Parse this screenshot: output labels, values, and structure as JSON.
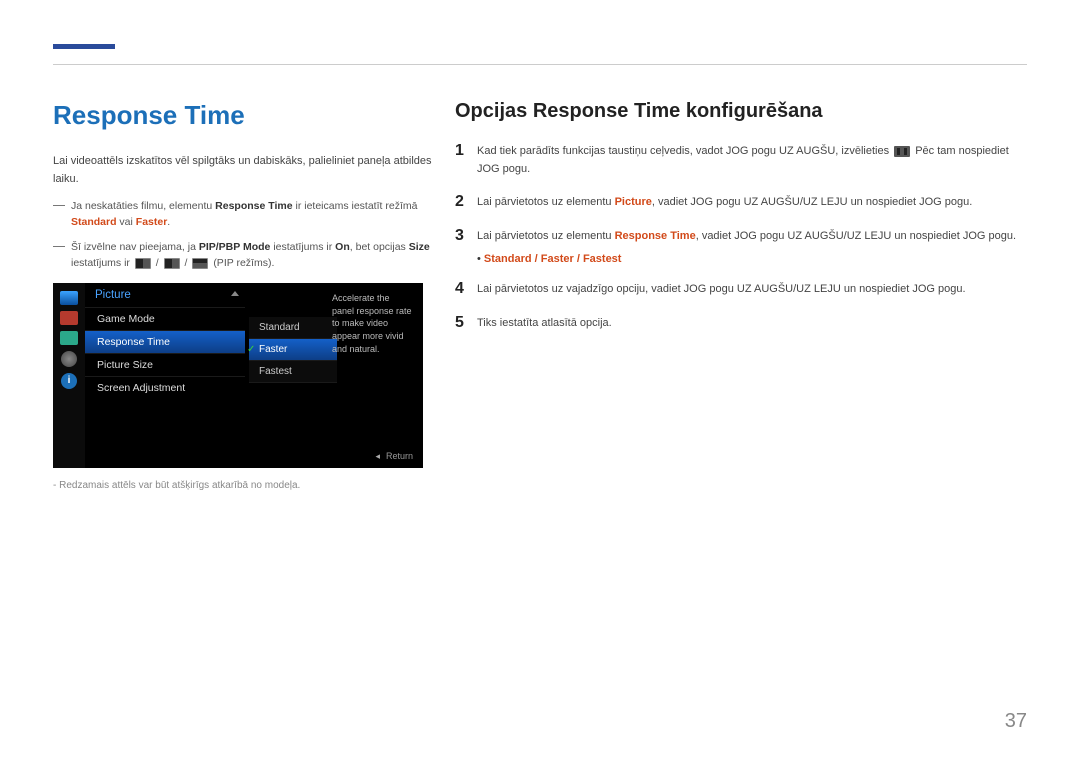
{
  "page_number": "37",
  "left": {
    "title": "Response Time",
    "intro": "Lai videoattēls izskatītos vēl spilgtāks un dabiskāks, palieliniet paneļa atbildes laiku.",
    "note1_pre": "Ja neskatāties filmu, elementu ",
    "note1_bold1": "Response Time",
    "note1_mid": " ir ieteicams iestatīt režīmā ",
    "note1_red1": "Standard",
    "note1_or": " vai ",
    "note1_red2": "Faster",
    "note1_end": ".",
    "note2_pre": "Šī izvēlne nav pieejama, ja ",
    "note2_bold1": "PIP/PBP Mode",
    "note2_mid1": " iestatījums ir ",
    "note2_bold2": "On",
    "note2_mid2": ", bet opcijas ",
    "note2_bold3": "Size",
    "note2_mid3": " iestatījums ir ",
    "note2_end": " (PIP režīms).",
    "footnote": "Redzamais attēls var būt atšķirīgs atkarībā no modeļa."
  },
  "menu": {
    "title": "Picture",
    "items": {
      "0": "Game Mode",
      "1": "Response Time",
      "2": "Picture Size",
      "3": "Screen Adjustment"
    },
    "sub": {
      "0": "Standard",
      "1": "Faster",
      "2": "Fastest"
    },
    "desc": "Accelerate the panel response rate to make video appear more vivid and natural.",
    "return": "Return",
    "info_char": "i"
  },
  "right": {
    "title": "Opcijas Response Time konfigurēšana",
    "steps": {
      "1": {
        "pre": "Kad tiek parādīts funkcijas taustiņu ceļvedis, vadot JOG pogu UZ AUGŠU, izvēlieties ",
        "post": " Pēc tam nospiediet JOG pogu."
      },
      "2": {
        "pre": "Lai pārvietotos uz elementu ",
        "red": "Picture",
        "post": ", vadiet JOG pogu UZ AUGŠU/UZ LEJU un nospiediet JOG pogu."
      },
      "3": {
        "pre": "Lai pārvietotos uz elementu ",
        "red": "Response Time",
        "post": ", vadiet JOG pogu UZ AUGŠU/UZ LEJU un nospiediet JOG pogu."
      },
      "bullet": "Standard / Faster / Fastest",
      "4": "Lai pārvietotos uz vajadzīgo opciju, vadiet JOG pogu UZ AUGŠU/UZ LEJU un nospiediet JOG pogu.",
      "5": "Tiks iestatīta atlasītā opcija."
    }
  }
}
